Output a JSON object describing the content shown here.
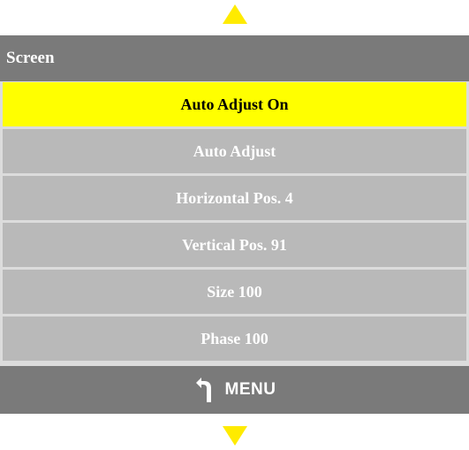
{
  "header": {
    "title": "Screen"
  },
  "menu": {
    "items": [
      {
        "label": "Auto Adjust On",
        "selected": true
      },
      {
        "label": "Auto Adjust",
        "selected": false
      },
      {
        "label": "Horizontal Pos. 4",
        "selected": false
      },
      {
        "label": "Vertical Pos. 91",
        "selected": false
      },
      {
        "label": "Size 100",
        "selected": false
      },
      {
        "label": "Phase 100",
        "selected": false
      }
    ]
  },
  "footer": {
    "label": "MENU",
    "icon": "return-arrow-icon"
  },
  "nav": {
    "up_icon": "arrow-up-icon",
    "down_icon": "arrow-down-icon"
  },
  "colors": {
    "highlight": "#ffff00",
    "arrow": "#ffeb00",
    "bar": "#7a7a7a",
    "item": "#b9b9b9",
    "panel": "#dcdcdc"
  }
}
